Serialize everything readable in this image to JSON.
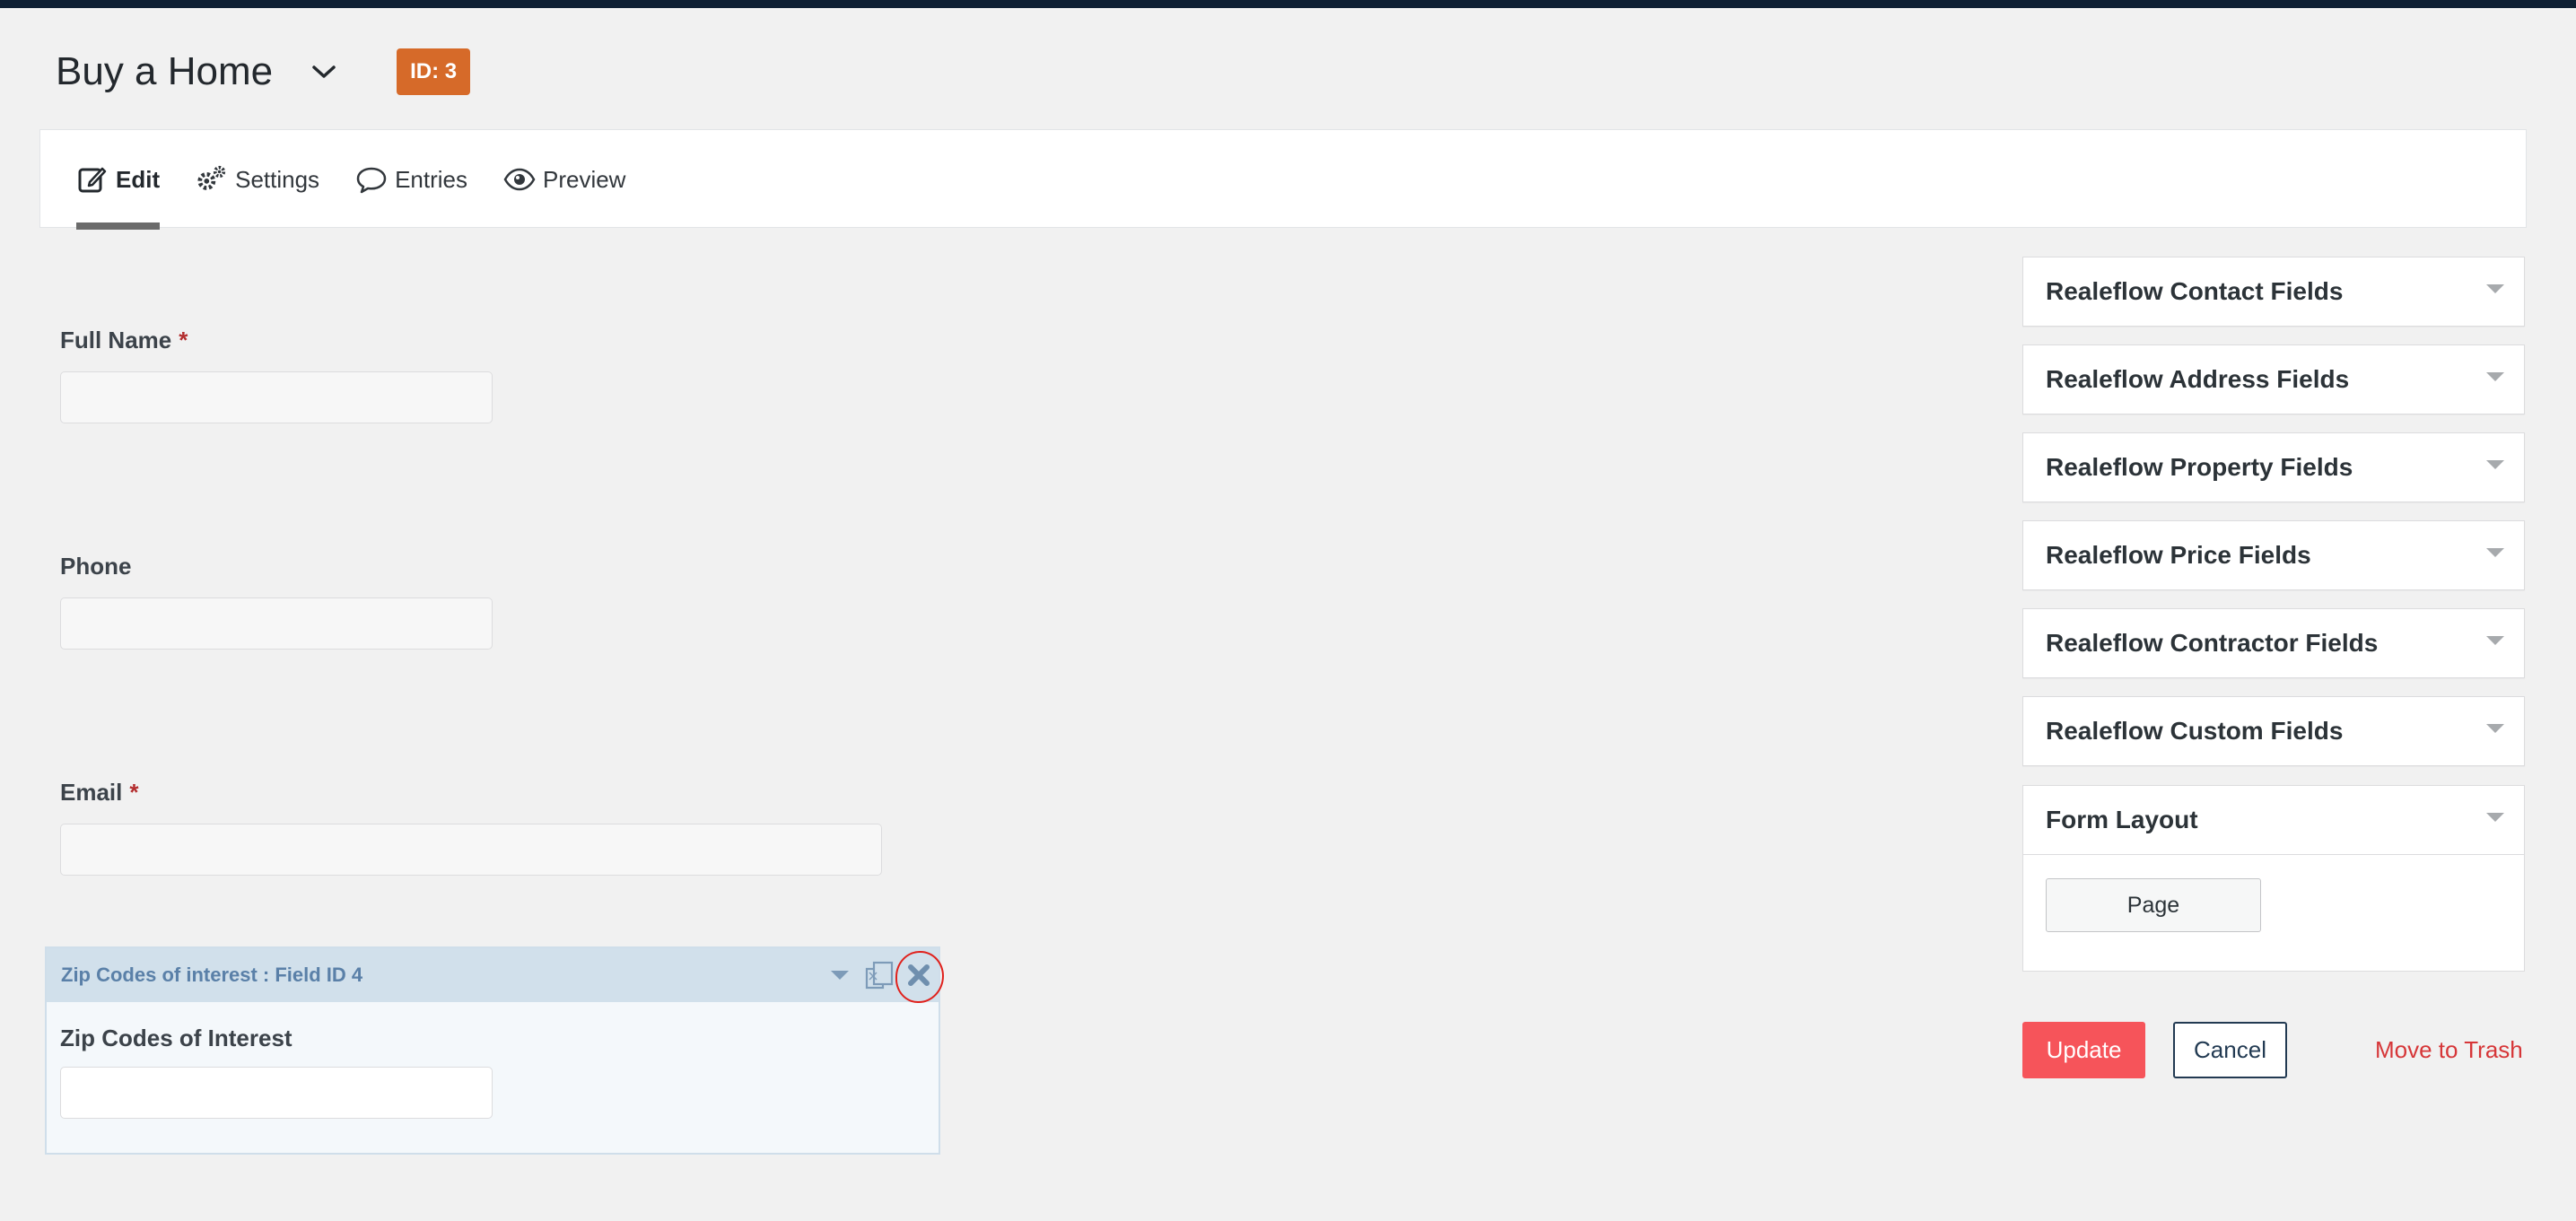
{
  "header": {
    "form_title": "Buy a Home",
    "id_badge": "ID: 3"
  },
  "tabs": [
    {
      "label": "Edit",
      "icon": "edit-icon",
      "active": true
    },
    {
      "label": "Settings",
      "icon": "gears-icon",
      "active": false
    },
    {
      "label": "Entries",
      "icon": "speech-bubble-icon",
      "active": false
    },
    {
      "label": "Preview",
      "icon": "eye-icon",
      "active": false
    }
  ],
  "fields": {
    "full_name": {
      "label": "Full Name",
      "required_mark": "*",
      "value": ""
    },
    "phone": {
      "label": "Phone",
      "value": ""
    },
    "email": {
      "label": "Email",
      "required_mark": "*",
      "value": ""
    },
    "zip": {
      "header_title": "Zip Codes of interest : Field ID 4",
      "label": "Zip Codes of Interest",
      "value": ""
    }
  },
  "sidebar": {
    "groups": [
      {
        "title": "Realeflow Contact Fields"
      },
      {
        "title": "Realeflow Address Fields"
      },
      {
        "title": "Realeflow Property Fields"
      },
      {
        "title": "Realeflow Price Fields"
      },
      {
        "title": "Realeflow Contractor Fields"
      },
      {
        "title": "Realeflow Custom Fields"
      }
    ],
    "form_layout": {
      "title": "Form Layout",
      "page_button": "Page"
    }
  },
  "actions": {
    "update": "Update",
    "cancel": "Cancel",
    "trash": "Move to Trash"
  },
  "colors": {
    "badge": "#d66a29",
    "update": "#f6545a",
    "trash": "#d63638",
    "annotation_circle": "#e0211c"
  }
}
